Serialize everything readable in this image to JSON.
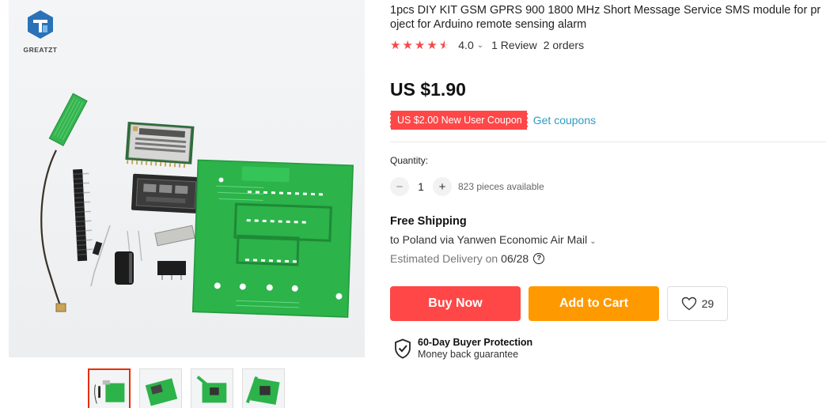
{
  "brand": {
    "name": "GREATZT"
  },
  "product": {
    "title": "1pcs DIY KIT GSM GPRS 900 1800 MHz Short Message Service SMS module for project for Arduino remote sensing alarm",
    "rating": "4.0",
    "rating_stars": 4,
    "reviews": "1 Review",
    "orders": "2 orders",
    "price": "US $1.90"
  },
  "coupon": {
    "label": "US $2.00 New User Coupon",
    "link": "Get coupons"
  },
  "quantity": {
    "label": "Quantity:",
    "value": "1",
    "available": "823 pieces available",
    "minus": "−",
    "plus": "+"
  },
  "shipping": {
    "title": "Free Shipping",
    "destination": "to Poland via Yanwen Economic Air Mail",
    "delivery_label": "Estimated Delivery on",
    "delivery_date": "06/28",
    "help_icon": "?"
  },
  "actions": {
    "buy_now": "Buy Now",
    "add_to_cart": "Add to Cart",
    "wishlist_count": "29"
  },
  "protection": {
    "title": "60-Day Buyer Protection",
    "subtitle": "Money back guarantee"
  },
  "colors": {
    "accent_red": "#ff4747",
    "accent_orange": "#ff9900",
    "link_blue": "#2e9cc3",
    "pcb_green": "#2cb34a"
  },
  "icons": [
    "brand-logo",
    "star-icon",
    "chevron-down-icon",
    "help-icon",
    "heart-icon",
    "shield-check-icon"
  ],
  "gallery": {
    "thumbnail_count": 4,
    "active_index": 0
  }
}
